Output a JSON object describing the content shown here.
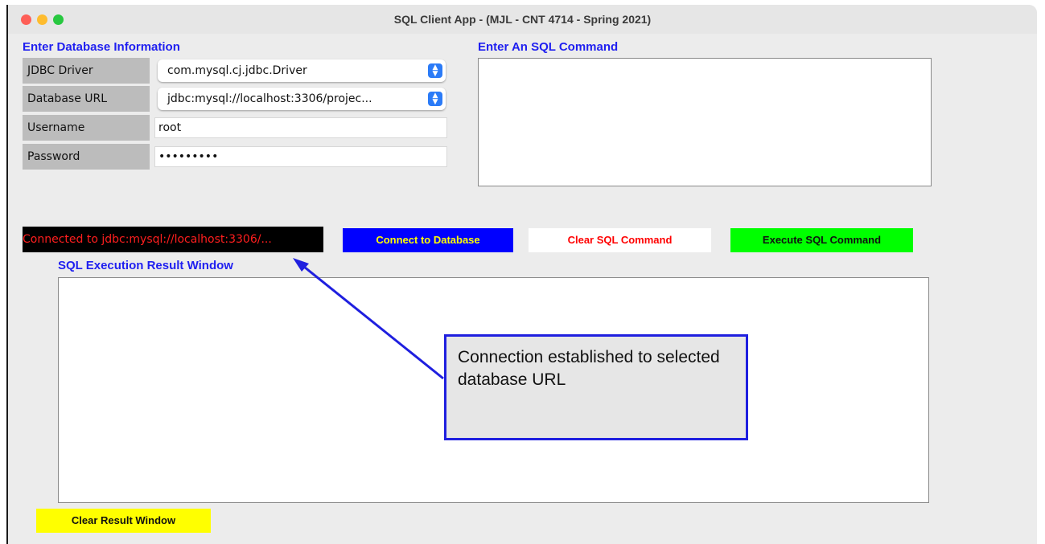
{
  "window": {
    "title": "SQL Client App - (MJL - CNT 4714 - Spring 2021)"
  },
  "db_info": {
    "heading": "Enter Database Information",
    "fields": {
      "driver": {
        "label": "JDBC Driver",
        "value": "com.mysql.cj.jdbc.Driver"
      },
      "url": {
        "label": "Database URL",
        "value": "jdbc:mysql://localhost:3306/projec..."
      },
      "username": {
        "label": "Username",
        "value": "root"
      },
      "password": {
        "label": "Password",
        "value": "•••••••••"
      }
    }
  },
  "sql_command": {
    "heading": "Enter An SQL Command",
    "value": ""
  },
  "status": {
    "text": "Connected to jdbc:mysql://localhost:3306/..."
  },
  "buttons": {
    "connect": "Connect to Database",
    "clear_sql": "Clear SQL Command",
    "execute": "Execute SQL Command",
    "clear_result": "Clear Result Window"
  },
  "result": {
    "heading": "SQL Execution Result Window"
  },
  "callout": {
    "text": "Connection established to selected database URL"
  },
  "icons": {
    "select_chevron": "up-down-chevron-icon"
  },
  "colors": {
    "heading": "#1f1ff0",
    "connect_bg": "#0000ff",
    "connect_fg": "#ffff00",
    "clear_sql_fg": "#ff0000",
    "execute_bg": "#00ff00",
    "clear_result_bg": "#ffff00",
    "status_fg": "#ff1e1e",
    "callout_border": "#1f1fdf"
  }
}
